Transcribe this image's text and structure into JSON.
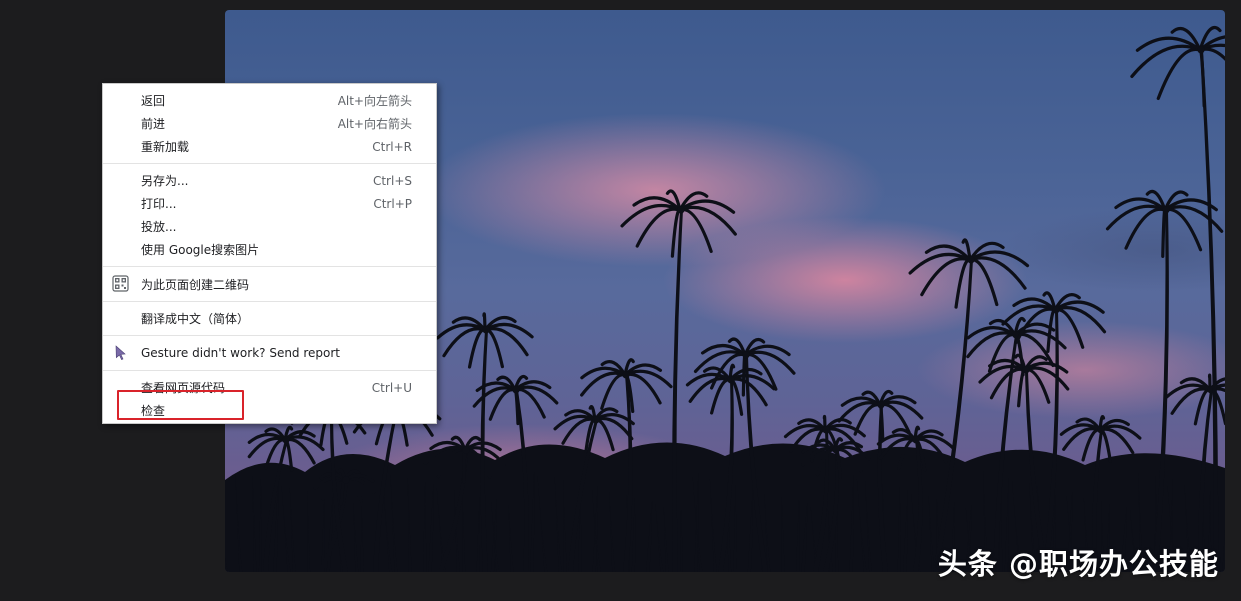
{
  "menu": {
    "group1": [
      {
        "label": "返回",
        "shortcut": "Alt+向左箭头"
      },
      {
        "label": "前进",
        "shortcut": "Alt+向右箭头"
      },
      {
        "label": "重新加载",
        "shortcut": "Ctrl+R"
      }
    ],
    "group2": [
      {
        "label": "另存为...",
        "shortcut": "Ctrl+S"
      },
      {
        "label": "打印...",
        "shortcut": "Ctrl+P"
      },
      {
        "label": "投放...",
        "shortcut": ""
      },
      {
        "label": "使用 Google搜索图片",
        "shortcut": ""
      }
    ],
    "qr": {
      "label": "为此页面创建二维码",
      "icon": "qr-code-icon"
    },
    "translate": {
      "label": "翻译成中文（简体）"
    },
    "gesture": {
      "label": "Gesture didn't work? Send report",
      "icon": "cursor-arrow-icon"
    },
    "group5": [
      {
        "label": "查看网页源代码",
        "shortcut": "Ctrl+U"
      },
      {
        "label": "检查",
        "shortcut": ""
      }
    ]
  },
  "highlight": {
    "color": "#d9232a",
    "target": "检查"
  },
  "watermark": {
    "text": "头条 @职场办公技能"
  },
  "colors": {
    "background": "#1c1c1e",
    "menu_bg": "#ffffff"
  }
}
